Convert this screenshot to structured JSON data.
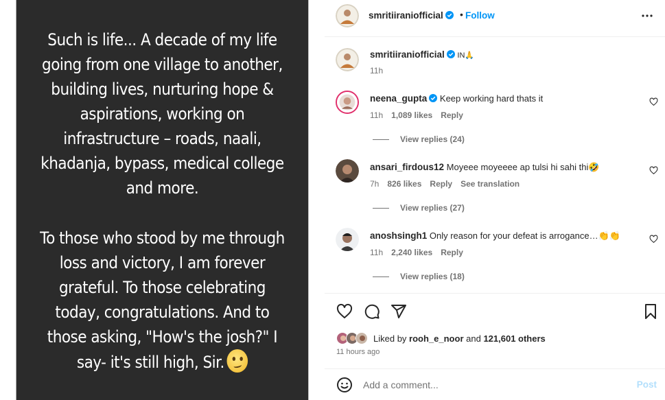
{
  "post_image": {
    "paragraph1": [
      "Such is life... A decade of my life",
      "going from one village to another,",
      "building lives, nurturing hope &",
      "aspirations, working on",
      "infrastructure – roads, naali,",
      "khadanja, bypass, medical college",
      "and more."
    ],
    "paragraph2": [
      "To those who stood by me through",
      "loss and victory, I am forever",
      "grateful. To those celebrating",
      "today, congratulations. And to",
      "those asking, \"How's the josh?\" I",
      "say- it's still high, Sir."
    ],
    "emoji": "smiling-face-emoji"
  },
  "header": {
    "username": "smritiiraniofficial",
    "separator": "•",
    "follow_label": "Follow",
    "more_icon": "more-options-icon"
  },
  "caption": {
    "username": "smritiiraniofficial",
    "text": "IN🙏",
    "time": "11h"
  },
  "comments": [
    {
      "username": "neena_gupta",
      "verified": true,
      "text": "Keep working hard thats it",
      "time": "11h",
      "likes": "1,089 likes",
      "reply": "Reply",
      "translation": "",
      "view_replies": "View replies (24)"
    },
    {
      "username": "ansari_firdous12",
      "verified": false,
      "text": "Moyeee moyeeee ap tulsi hi sahi thi🤣",
      "time": "7h",
      "likes": "826 likes",
      "reply": "Reply",
      "translation": "See translation",
      "view_replies": "View replies (27)"
    },
    {
      "username": "anoshsingh1",
      "verified": false,
      "text": "Only reason for your defeat is arrogance…👏👏",
      "time": "11h",
      "likes": "2,240 likes",
      "reply": "Reply",
      "translation": "",
      "view_replies": "View replies (18)"
    }
  ],
  "actions": {
    "like_icon": "heart-icon",
    "comment_icon": "comment-icon",
    "share_icon": "share-icon",
    "save_icon": "bookmark-icon"
  },
  "likes": {
    "prefix": "Liked by ",
    "user": "rooh_e_noor",
    "middle": " and ",
    "count": "121,601 others"
  },
  "time_ago": "11 hours ago",
  "add_comment": {
    "placeholder": "Add a comment...",
    "post_label": "Post"
  },
  "colors": {
    "accent": "#0095f6",
    "post_disabled": "#b2dffc",
    "image_bg": "#2b2b2b",
    "muted": "#737373"
  }
}
